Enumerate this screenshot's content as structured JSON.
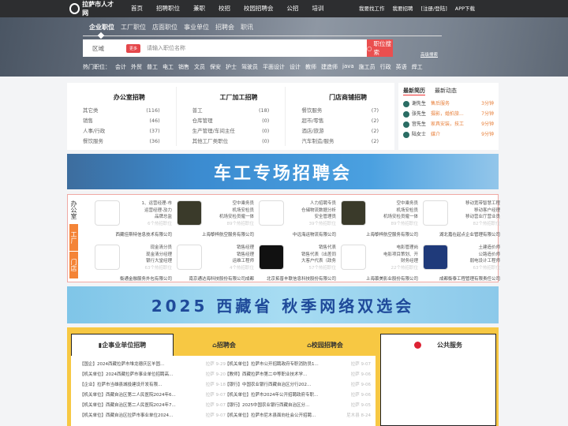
{
  "nav": {
    "logo": "拉萨市人才网",
    "links": [
      "首页",
      "招聘职位",
      "兼职",
      "校招",
      "校园招聘会",
      "公招",
      "培训"
    ],
    "right": [
      "我要找工作",
      "我要招聘",
      "[注册/登陆]",
      "APP下载"
    ]
  },
  "search": {
    "tabs": [
      "企业职位",
      "工厂职位",
      "店面职位",
      "事业单位",
      "招聘会",
      "职讯"
    ],
    "area": "区域",
    "more": "更多",
    "placeholder": "请输入职位名称",
    "button": "职位搜索",
    "advanced": "高级搜索",
    "hot_label": "热门职位：",
    "hot": [
      "会计",
      "外贸",
      "普工",
      "电工",
      "销售",
      "文员",
      "保安",
      "护士",
      "驾驶员",
      "平面设计",
      "设计",
      "教师",
      "建造师",
      "java",
      "施工员",
      "行政",
      "英语",
      "焊工"
    ]
  },
  "categories": [
    {
      "title": "办公室招聘",
      "items": [
        [
          "其它类",
          "(116)"
        ],
        [
          "销售",
          "(46)"
        ],
        [
          "人事/行政",
          "(37)"
        ],
        [
          "餐饮服务",
          "(36)"
        ]
      ]
    },
    {
      "title": "工厂加工招聘",
      "items": [
        [
          "普工",
          "(18)"
        ],
        [
          "仓库管理",
          "(0)"
        ],
        [
          "生产管理/车间主任",
          "(0)"
        ],
        [
          "其他工厂类职位",
          "(0)"
        ]
      ]
    },
    {
      "title": "门店商铺招聘",
      "items": [
        [
          "餐饮服务",
          "(7)"
        ],
        [
          "超市/零售",
          "(2)"
        ],
        [
          "酒店/旅游",
          "(2)"
        ],
        [
          "汽车制造/服务",
          "(2)"
        ]
      ]
    }
  ],
  "resume": {
    "tabs": [
      "最新简历",
      "最新动态"
    ],
    "items": [
      [
        "谢先生",
        "售后服务",
        "3分钟"
      ],
      [
        "张先生",
        "摄影，婚拍旅...",
        "7分钟"
      ],
      [
        "宫先生",
        "家具安装，技工",
        "9分钟"
      ],
      [
        "陆女士",
        "媒介",
        "9分钟"
      ]
    ]
  },
  "banner1": "车工专场招聘会",
  "side_tabs": [
    "办公室",
    "工厂",
    "门店"
  ],
  "companies": [
    {
      "jobs": [
        "1、运营经理-市",
        "运营经理-劢力",
        "品牌总监"
      ],
      "count": "6个热招职位",
      "name": "西藏佳斯特信息技术有限公司",
      "logo": "#fff"
    },
    {
      "jobs": [
        "空中乘务员",
        "机场安检员",
        "机场安检员僱一体"
      ],
      "count": "89个热招职位",
      "name": "上海黎梓航空服务有限公司",
      "logo": "#3a3a2a"
    },
    {
      "jobs": [
        "人力招聘专员",
        "仓储物流数据分析",
        "安全管理员"
      ],
      "count": "39个热招职位",
      "name": "中远海运物流有限公司",
      "logo": "#fff"
    },
    {
      "jobs": [
        "空中乘务员",
        "机场安检员",
        "机场安检员僱一体"
      ],
      "count": "89个热招职位",
      "name": "上海黎梓航空服务有限公司",
      "logo": "#3a3a2a"
    },
    {
      "jobs": [
        "移动宽带智慧工程",
        "移动客户经理",
        "移动营业厅营业员"
      ],
      "count": "82个热招职位",
      "name": "湖北嘉在起点企业管理有限公司",
      "logo": "#fff"
    },
    {
      "jobs": [
        "现金清分员",
        "现金清分经理",
        "银行大堂经理"
      ],
      "count": "63个热招职位",
      "name": "衡通金融服务外包有限公司",
      "logo": "#fff"
    },
    {
      "jobs": [
        "销售经理",
        "销售经理",
        "运维工程师"
      ],
      "count": "4个热招职位",
      "name": "南京通达海科技股份有限公司成都",
      "logo": "#fff"
    },
    {
      "jobs": [
        "销售代表",
        "销售代表（出差同",
        "大客户代表（政务"
      ],
      "count": "57个热招职位",
      "name": "北京拓普丰联信息科技股份有限公司",
      "logo": "#111"
    },
    {
      "jobs": [
        "电影管理岗",
        "电影项目策划、开",
        "财务经理"
      ],
      "count": "22个热招职位",
      "name": "上海慕美影业股份有限公司",
      "logo": "#fff"
    },
    {
      "jobs": [
        "土建造价师",
        "公路造价师",
        "弱电设计工程师"
      ],
      "count": "63个热招职位",
      "name": "成都衡泰工程管理有限责任公司",
      "logo": "#1f3a7a"
    }
  ],
  "banner2": "2025 西藏省 秋季网络双选会",
  "news": {
    "tabs": [
      "企事业单位招聘",
      "招聘会",
      "校园招聘会"
    ],
    "left": [
      [
        "【国企】2024西藏拉萨市堆龙德庆区羊固...",
        "拉萨 9-29"
      ],
      [
        "【机关单位】2024西藏拉萨市事业单位招聘高...",
        "拉萨 9-20"
      ],
      [
        "【企业】拉萨市当雄县城投建设开发有限...",
        "拉萨 9-18"
      ],
      [
        "【机关单位】西藏自治区第二人民医院2024年6...",
        "拉萨 9-07"
      ],
      [
        "【机关单位】西藏自治区第二人民医院2024年7...",
        "拉萨 9-07"
      ],
      [
        "【机关单位】西藏自治区拉萨市事业单位2024...",
        "拉萨 9-07"
      ]
    ],
    "right": [
      [
        "【机关单位】拉萨市公开招聘政府专职消防员1...",
        "拉萨 9-07"
      ],
      [
        "【教师】西藏拉萨市第二中等职业技术学...",
        "拉萨 9-06"
      ],
      [
        "【银行】中国农业银行西藏自治区分行202...",
        "拉萨 9-06"
      ],
      [
        "【机关单位】拉萨市2024年公开招聘政府专职...",
        "拉萨 9-06"
      ],
      [
        "【银行】2025中国农业银行西藏自治区分...",
        "拉萨 9-05"
      ],
      [
        "【机关单位】拉萨市尼木县面向社会公开招聘...",
        "尼木县 8-24"
      ]
    ]
  },
  "public": {
    "title": "公共服务"
  }
}
